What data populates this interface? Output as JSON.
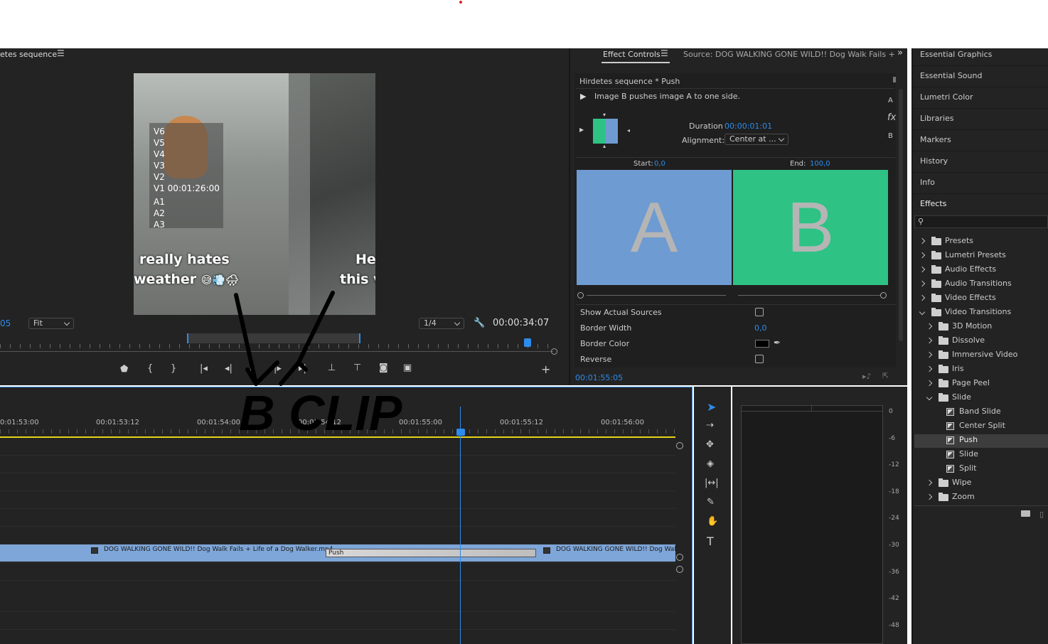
{
  "program": {
    "panel_title": "etes sequence",
    "overlay_tracks": [
      "V6",
      "V5",
      "V4",
      "V3",
      "V2",
      "V1"
    ],
    "overlay_timecode": "00:01:26:00",
    "overlay_audio": [
      "A1",
      "A2",
      "A3"
    ],
    "caption_left_1": "really hates",
    "caption_left_2": "weather",
    "caption_left_emoji": "😅💨🌧",
    "caption_right_1": "He",
    "caption_right_2": "this v",
    "timecode_left": "05",
    "zoom_value": "Fit",
    "resolution_value": "1/4",
    "duration": "00:00:34:07"
  },
  "effect_controls": {
    "tab_active": "Effect Controls",
    "tab_source": "Source: DOG WALKING GONE WILD!!  Dog Walk Fails +",
    "sequence_label": "Hirdetes sequence * Push",
    "description": "Image B pushes image A to one side.",
    "duration_label": "Duration",
    "duration_value": "00:00:01:01",
    "alignment_label": "Alignment:",
    "alignment_value": "Center at ...",
    "side_a": "A",
    "side_fx": "fx",
    "side_b": "B",
    "start_label": "Start:",
    "start_value": "0,0",
    "end_label": "End:",
    "end_value": "100,0",
    "preview_a": "A",
    "preview_b": "B",
    "show_actual_sources": "Show Actual Sources",
    "border_width_label": "Border Width",
    "border_width_value": "0,0",
    "border_color_label": "Border Color",
    "reverse_label": "Reverse",
    "footer_timecode": "00:01:55:05"
  },
  "right_panels": {
    "items": [
      "Essential Graphics",
      "Essential Sound",
      "Lumetri Color",
      "Libraries",
      "Markers",
      "History",
      "Info",
      "Effects"
    ],
    "tree": [
      {
        "label": "Presets",
        "level": 0,
        "type": "star-folder",
        "open": false
      },
      {
        "label": "Lumetri Presets",
        "level": 0,
        "type": "star-folder",
        "open": false
      },
      {
        "label": "Audio Effects",
        "level": 0,
        "type": "folder",
        "open": false
      },
      {
        "label": "Audio Transitions",
        "level": 0,
        "type": "folder",
        "open": false
      },
      {
        "label": "Video Effects",
        "level": 0,
        "type": "folder",
        "open": false
      },
      {
        "label": "Video Transitions",
        "level": 0,
        "type": "folder",
        "open": true
      },
      {
        "label": "3D Motion",
        "level": 1,
        "type": "folder",
        "open": false
      },
      {
        "label": "Dissolve",
        "level": 1,
        "type": "folder",
        "open": false
      },
      {
        "label": "Immersive Video",
        "level": 1,
        "type": "folder",
        "open": false
      },
      {
        "label": "Iris",
        "level": 1,
        "type": "folder",
        "open": false
      },
      {
        "label": "Page Peel",
        "level": 1,
        "type": "folder",
        "open": false
      },
      {
        "label": "Slide",
        "level": 1,
        "type": "folder",
        "open": true
      },
      {
        "label": "Band Slide",
        "level": 2,
        "type": "item"
      },
      {
        "label": "Center Split",
        "level": 2,
        "type": "item"
      },
      {
        "label": "Push",
        "level": 2,
        "type": "item",
        "selected": true
      },
      {
        "label": "Slide",
        "level": 2,
        "type": "item"
      },
      {
        "label": "Split",
        "level": 2,
        "type": "item"
      },
      {
        "label": "Wipe",
        "level": 1,
        "type": "folder",
        "open": false
      },
      {
        "label": "Zoom",
        "level": 1,
        "type": "folder",
        "open": false
      }
    ]
  },
  "timeline": {
    "ruler": [
      "0:01:53:00",
      "00:01:53:12",
      "00:01:54:00",
      "00:01:54:12",
      "00:01:55:00",
      "00:01:55:12",
      "00:01:56:00"
    ],
    "clip_a_label": "DOG WALKING GONE WILD!!  Dog Walk Fails + Life of a Dog Walker.mp4",
    "transition_label": "Push",
    "clip_b_label": "DOG WALKING GONE WILD!!  Dog Wal",
    "annotation_text": "B CLIP"
  },
  "meter": {
    "scale": [
      "0",
      "-6",
      "-12",
      "-18",
      "-24",
      "-30",
      "-36",
      "-42",
      "-48"
    ]
  },
  "colors": {
    "panel_bg": "#232323",
    "accent_blue": "#2d8ceb",
    "clip_blue": "#7ea6d8",
    "preview_a": "#6e9bd1",
    "preview_b": "#2ec285",
    "work_area_yellow": "#e6d21a"
  }
}
